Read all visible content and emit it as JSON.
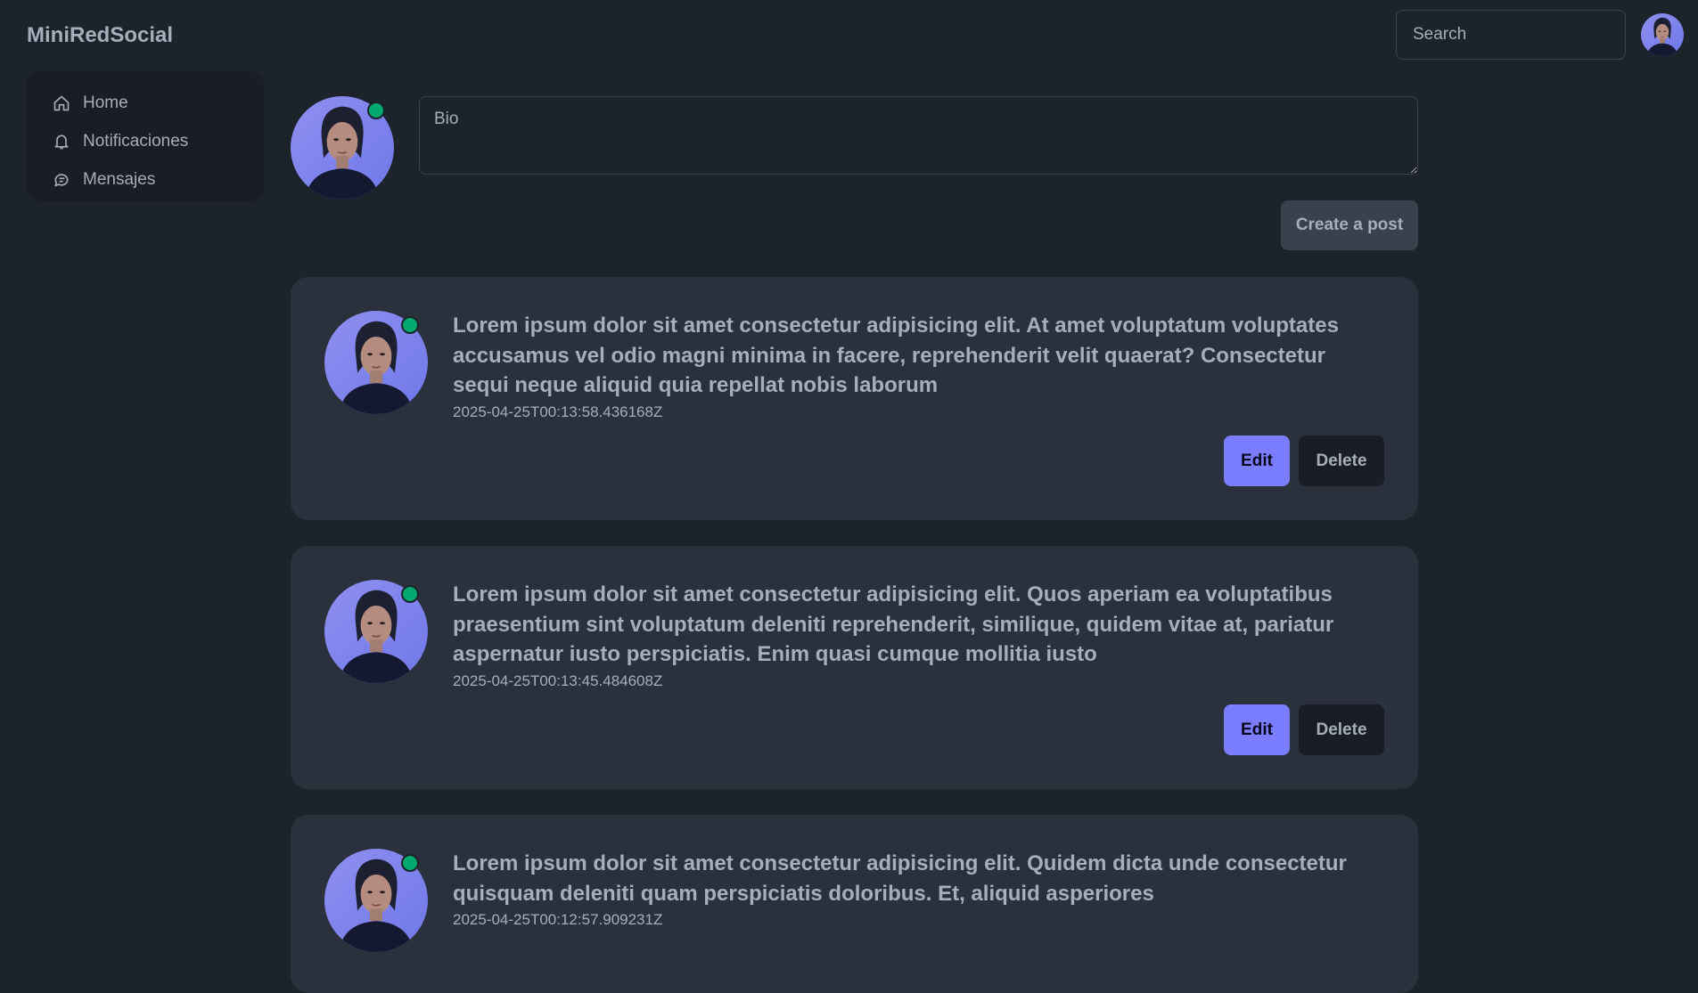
{
  "app": {
    "brand": "MiniRedSocial"
  },
  "navbar": {
    "search_placeholder": "Search",
    "avatar_icon": "user-avatar"
  },
  "sidebar": {
    "items": [
      {
        "label": "Home",
        "icon": "home-icon"
      },
      {
        "label": "Notificaciones",
        "icon": "bell-icon"
      },
      {
        "label": "Mensajes",
        "icon": "chat-icon"
      }
    ]
  },
  "composer": {
    "bio_placeholder": "Bio",
    "create_label": "Create a post"
  },
  "posts": [
    {
      "text": "Lorem ipsum dolor sit amet consectetur adipisicing elit. At amet voluptatum voluptates accusamus vel odio magni minima in facere, reprehenderit velit quaerat? Consectetur sequi neque aliquid quia repellat nobis laborum",
      "date": "2025-04-25T00:13:58.436168Z",
      "edit_label": "Edit",
      "delete_label": "Delete"
    },
    {
      "text": "Lorem ipsum dolor sit amet consectetur adipisicing elit. Quos aperiam ea voluptatibus praesentium sint voluptatum deleniti reprehenderit, similique, quidem vitae at, pariatur aspernatur iusto perspiciatis. Enim quasi cumque mollitia iusto",
      "date": "2025-04-25T00:13:45.484608Z",
      "edit_label": "Edit",
      "delete_label": "Delete"
    },
    {
      "text": "Lorem ipsum dolor sit amet consectetur adipisicing elit. Quidem dicta unde consectetur quisquam deleniti quam perspiciatis doloribus. Et, aliquid asperiores",
      "date": "2025-04-25T00:12:57.909231Z",
      "edit_label": "Edit",
      "delete_label": "Delete"
    }
  ],
  "colors": {
    "background": "#1d232a",
    "card": "#2a313c",
    "primary": "#7b7dff",
    "online": "#00a96e",
    "text": "#a6adbb"
  }
}
